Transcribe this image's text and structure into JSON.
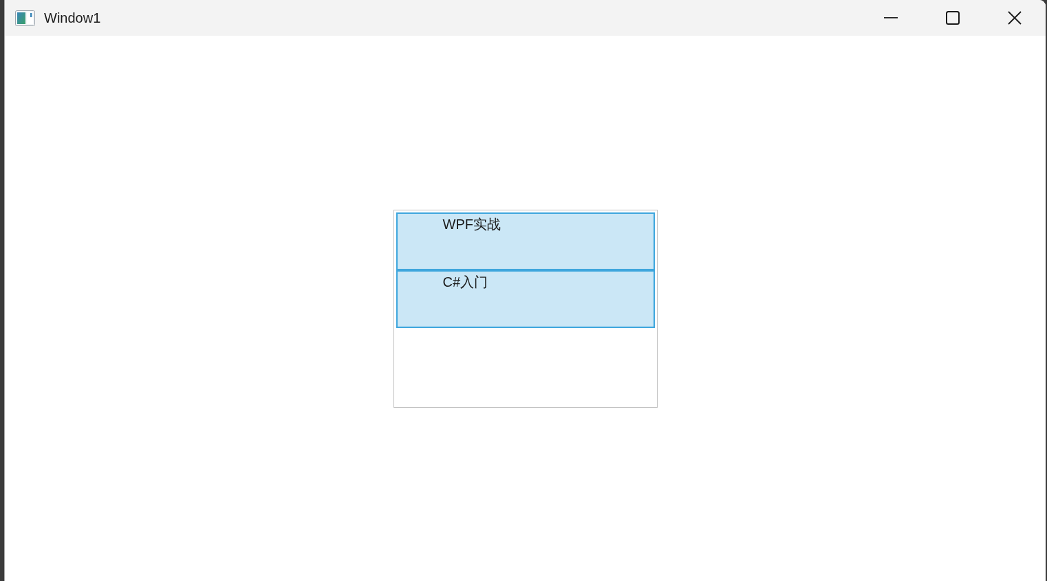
{
  "window": {
    "title": "Window1"
  },
  "list": {
    "items": [
      {
        "label": "WPF实战",
        "selected": true
      },
      {
        "label": "C#入门",
        "selected": true
      }
    ]
  }
}
